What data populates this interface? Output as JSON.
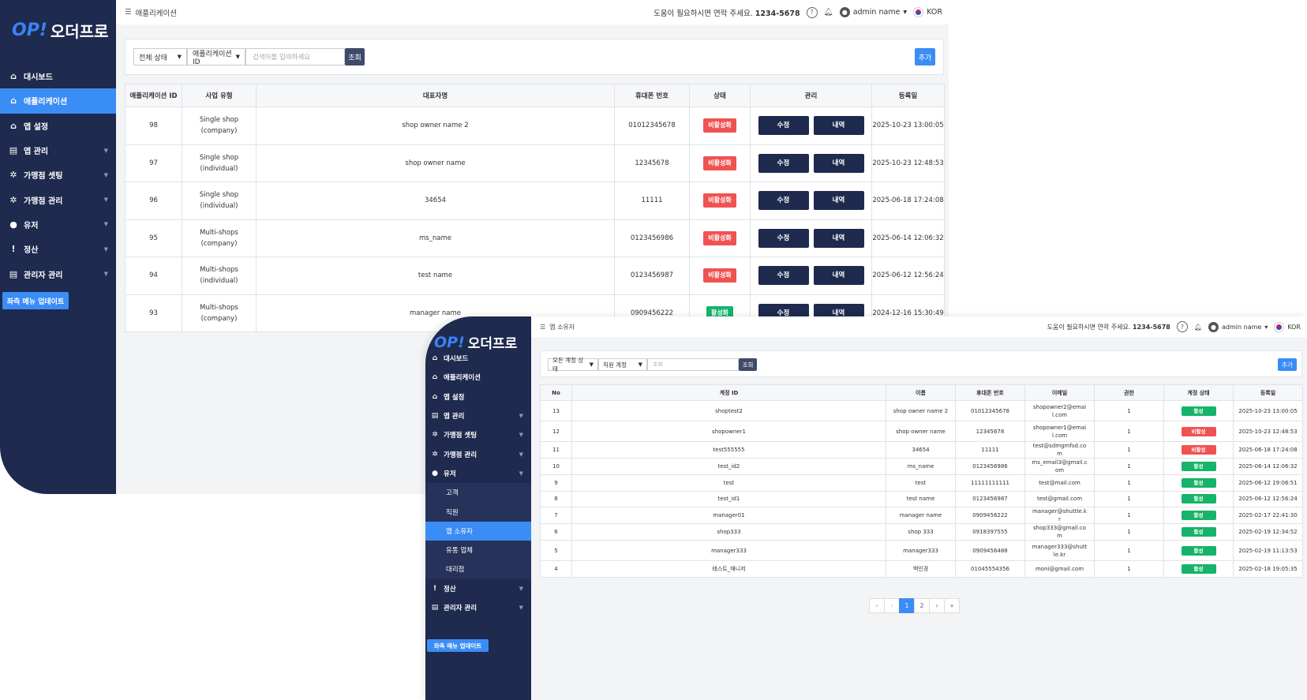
{
  "screen1": {
    "logo": {
      "mark": "OP!",
      "text": "오더프로"
    },
    "breadcrumb": "애플리케이션",
    "topbar": {
      "help_text": "도움이 필요하시면 연락 주세요.",
      "phone": "1234-5678",
      "user": "admin name",
      "language": "KOR"
    },
    "menu": [
      {
        "label": "대시보드",
        "icon": "home-icon",
        "active": false,
        "has_chevron": false
      },
      {
        "label": "애플리케이션",
        "icon": "home-icon",
        "active": true,
        "has_chevron": false
      },
      {
        "label": "앱 설정",
        "icon": "home-icon",
        "active": false,
        "has_chevron": false
      },
      {
        "label": "앱 관리",
        "icon": "document-icon",
        "active": false,
        "has_chevron": true
      },
      {
        "label": "가맹점 셋팅",
        "icon": "gear-icon",
        "active": false,
        "has_chevron": true
      },
      {
        "label": "가맹점 관리",
        "icon": "gear-icon",
        "active": false,
        "has_chevron": true
      },
      {
        "label": "유저",
        "icon": "user-icon",
        "active": false,
        "has_chevron": true
      },
      {
        "label": "정산",
        "icon": "info-icon",
        "active": false,
        "has_chevron": true
      },
      {
        "label": "관리자 관리",
        "icon": "document-icon",
        "active": false,
        "has_chevron": true
      }
    ],
    "update_button": "좌측 메뉴 업데이트",
    "filters": {
      "status": "전체 상태",
      "field": "애플리케이션 ID",
      "search_placeholder": "검색어를 입력하세요",
      "search_button": "조회",
      "add_button": "추가"
    },
    "table": {
      "headers": [
        "애플리케이션 ID",
        "사업 유형",
        "대표자명",
        "휴대폰 번호",
        "상태",
        "관리",
        "등록일"
      ],
      "edit_label": "수정",
      "history_label": "내역",
      "rows": [
        {
          "id": "98",
          "type": "Single shop (company)",
          "owner": "shop owner name 2",
          "phone": "01012345678",
          "status": "비활성화",
          "active": false,
          "date": "2025-10-23 13:00:05"
        },
        {
          "id": "97",
          "type": "Single shop (individual)",
          "owner": "shop owner name",
          "phone": "12345678",
          "status": "비활성화",
          "active": false,
          "date": "2025-10-23 12:48:53"
        },
        {
          "id": "96",
          "type": "Single shop (individual)",
          "owner": "34654",
          "phone": "11111",
          "status": "비활성화",
          "active": false,
          "date": "2025-06-18 17:24:08"
        },
        {
          "id": "95",
          "type": "Multi-shops (company)",
          "owner": "ms_name",
          "phone": "0123456986",
          "status": "비활성화",
          "active": false,
          "date": "2025-06-14 12:06:32"
        },
        {
          "id": "94",
          "type": "Multi-shops (individual)",
          "owner": "test name",
          "phone": "0123456987",
          "status": "비활성화",
          "active": false,
          "date": "2025-06-12 12:56:24"
        },
        {
          "id": "93",
          "type": "Multi-shops (company)",
          "owner": "manager name",
          "phone": "0909456222",
          "status": "활성화",
          "active": true,
          "date": "2024-12-16 15:30:49"
        }
      ]
    }
  },
  "screen2": {
    "logo": {
      "mark": "OP!",
      "text": "오더프로"
    },
    "breadcrumb": "앱 소유자",
    "topbar": {
      "help_text": "도움이 필요하시면 연락 주세요.",
      "phone": "1234-5678",
      "user": "admin name",
      "language": "KOR"
    },
    "menu": [
      {
        "label": "대시보드",
        "icon": "home-icon",
        "active": false,
        "has_chevron": false
      },
      {
        "label": "애플리케이션",
        "icon": "home-icon",
        "active": false,
        "has_chevron": false
      },
      {
        "label": "앱 설정",
        "icon": "home-icon",
        "active": false,
        "has_chevron": false
      },
      {
        "label": "앱 관리",
        "icon": "document-icon",
        "active": false,
        "has_chevron": true
      },
      {
        "label": "가맹점 셋팅",
        "icon": "gear-icon",
        "active": false,
        "has_chevron": true
      },
      {
        "label": "가맹점 관리",
        "icon": "gear-icon",
        "active": false,
        "has_chevron": true
      },
      {
        "label": "유저",
        "icon": "user-icon",
        "active": false,
        "has_chevron": true,
        "expanded": true,
        "children": [
          {
            "label": "고객",
            "active": false
          },
          {
            "label": "직원",
            "active": false
          },
          {
            "label": "앱 소유자",
            "active": true
          },
          {
            "label": "유통 업체",
            "active": false
          },
          {
            "label": "대리점",
            "active": false
          }
        ]
      },
      {
        "label": "정산",
        "icon": "info-icon",
        "active": false,
        "has_chevron": true
      },
      {
        "label": "관리자 관리",
        "icon": "document-icon",
        "active": false,
        "has_chevron": true
      }
    ],
    "update_button": "좌측 메뉴 업데이트",
    "filters": {
      "status": "모든 계정 상태",
      "field": "직원 계정",
      "search_placeholder": "조회",
      "search_button": "조회",
      "add_button": "추가"
    },
    "table": {
      "headers": [
        "No",
        "계정 ID",
        "이름",
        "휴대폰 번호",
        "이메일",
        "권한",
        "계정 상태",
        "등록일"
      ],
      "rows": [
        {
          "no": "13",
          "account": "shoptest2",
          "name": "shop owner name 2",
          "phone": "01012345678",
          "email": "shopowner2@email.com",
          "role": "1",
          "status": "활성",
          "active": true,
          "date": "2025-10-23 13:00:05"
        },
        {
          "no": "12",
          "account": "shopowner1",
          "name": "shop owner name",
          "phone": "12345678",
          "email": "shopowner1@email.com",
          "role": "1",
          "status": "비활성",
          "active": false,
          "date": "2025-10-23 12:48:53"
        },
        {
          "no": "11",
          "account": "test555555",
          "name": "34654",
          "phone": "11111",
          "email": "test@sdmgmfsd.com",
          "role": "1",
          "status": "비활성",
          "active": false,
          "date": "2025-06-18 17:24:08"
        },
        {
          "no": "10",
          "account": "test_id2",
          "name": "ms_name",
          "phone": "0123456986",
          "email": "ms_email3@gmail.com",
          "role": "1",
          "status": "활성",
          "active": true,
          "date": "2025-06-14 12:06:32"
        },
        {
          "no": "9",
          "account": "test",
          "name": "test",
          "phone": "11111111111",
          "email": "test@mail.com",
          "role": "1",
          "status": "활성",
          "active": true,
          "date": "2025-06-12 19:06:51"
        },
        {
          "no": "8",
          "account": "test_id1",
          "name": "test name",
          "phone": "0123456987",
          "email": "test@gmail.com",
          "role": "1",
          "status": "활성",
          "active": true,
          "date": "2025-06-12 12:56:24"
        },
        {
          "no": "7",
          "account": "manager01",
          "name": "manager name",
          "phone": "0909456222",
          "email": "manager@shuttle.kr",
          "role": "1",
          "status": "활성",
          "active": true,
          "date": "2025-02-17 22:41:30"
        },
        {
          "no": "6",
          "account": "shop333",
          "name": "shop 333",
          "phone": "0918397555",
          "email": "shop333@gmail.com",
          "role": "1",
          "status": "활성",
          "active": true,
          "date": "2025-02-19 12:34:52"
        },
        {
          "no": "5",
          "account": "manager333",
          "name": "manager333",
          "phone": "0909456488",
          "email": "manager333@shuttle.kr",
          "role": "1",
          "status": "활성",
          "active": true,
          "date": "2025-02-19 11:13:53"
        },
        {
          "no": "4",
          "account": "테스트_매니저",
          "name": "백인경",
          "phone": "01045554356",
          "email": "moni@gmail.com",
          "role": "1",
          "status": "활성",
          "active": true,
          "date": "2025-02-18 19:05:35"
        }
      ]
    },
    "pagination": {
      "first": "«",
      "prev": "‹",
      "pages": [
        "1",
        "2"
      ],
      "current": "1",
      "next": "›",
      "last": "»"
    }
  },
  "colors": {
    "sidebar": "#1e2a4e",
    "accent": "#3b8df6",
    "inactive_badge": "#f05252",
    "active_badge": "#16b36a",
    "dark_button": "#1e2a4e"
  }
}
